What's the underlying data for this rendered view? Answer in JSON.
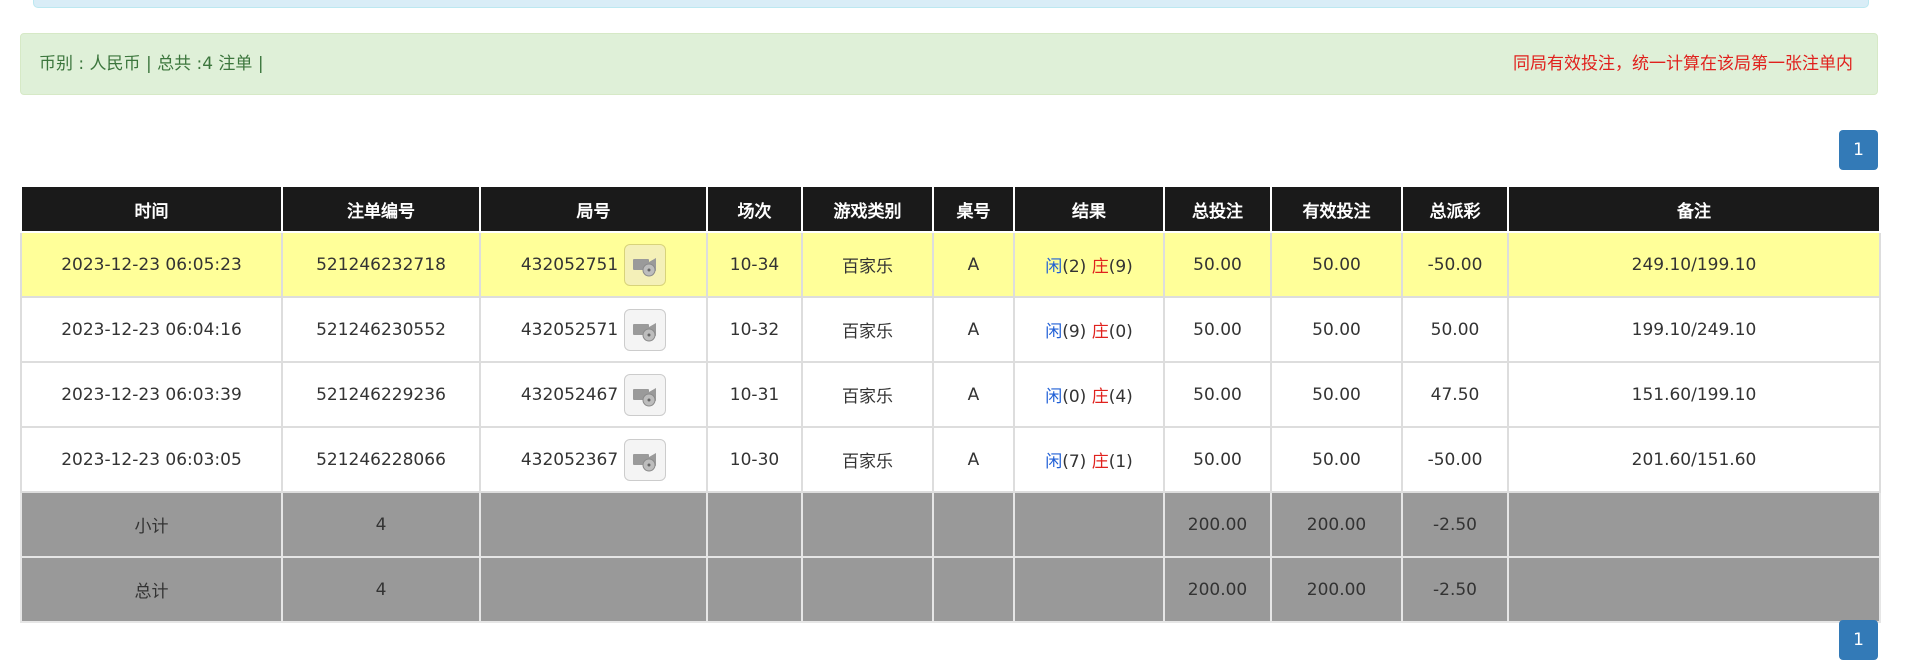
{
  "summary": {
    "left_text": "币别 : 人民币 | 总共 :4 注单 |",
    "right_text": "同局有效投注，统一计算在该局第一张注单内"
  },
  "pagination": {
    "current": "1"
  },
  "table": {
    "headers": [
      "时间",
      "注单编号",
      "局号",
      "场次",
      "游戏类别",
      "桌号",
      "结果",
      "总投注",
      "有效投注",
      "总派彩",
      "备注"
    ],
    "rows": [
      {
        "time": "2023-12-23 06:05:23",
        "bet_id": "521246232718",
        "round": "432052751",
        "session": "10-34",
        "game": "百家乐",
        "table": "A",
        "player_label": "闲",
        "player_score": "(2)",
        "banker_label": "庄",
        "banker_score": "(9)",
        "total_bet": "50.00",
        "valid_bet": "50.00",
        "payout": "-50.00",
        "note": "249.10/199.10"
      },
      {
        "time": "2023-12-23 06:04:16",
        "bet_id": "521246230552",
        "round": "432052571",
        "session": "10-32",
        "game": "百家乐",
        "table": "A",
        "player_label": "闲",
        "player_score": "(9)",
        "banker_label": "庄",
        "banker_score": "(0)",
        "total_bet": "50.00",
        "valid_bet": "50.00",
        "payout": "50.00",
        "note": "199.10/249.10"
      },
      {
        "time": "2023-12-23 06:03:39",
        "bet_id": "521246229236",
        "round": "432052467",
        "session": "10-31",
        "game": "百家乐",
        "table": "A",
        "player_label": "闲",
        "player_score": "(0)",
        "banker_label": "庄",
        "banker_score": "(4)",
        "total_bet": "50.00",
        "valid_bet": "50.00",
        "payout": "47.50",
        "note": "151.60/199.10"
      },
      {
        "time": "2023-12-23 06:03:05",
        "bet_id": "521246228066",
        "round": "432052367",
        "session": "10-30",
        "game": "百家乐",
        "table": "A",
        "player_label": "闲",
        "player_score": "(7)",
        "banker_label": "庄",
        "banker_score": "(1)",
        "total_bet": "50.00",
        "valid_bet": "50.00",
        "payout": "-50.00",
        "note": "201.60/151.60"
      }
    ],
    "subtotal": {
      "label": "小计",
      "count": "4",
      "total_bet": "200.00",
      "valid_bet": "200.00",
      "payout": "-2.50"
    },
    "total": {
      "label": "总计",
      "count": "4",
      "total_bet": "200.00",
      "valid_bet": "200.00",
      "payout": "-2.50"
    }
  },
  "colors": {
    "header_bg": "#1a1a1a",
    "highlight_row": "#ffff99",
    "summary_row": "#999999",
    "blue": "#1f5fd6",
    "red": "#e0211d",
    "pager": "#337ab7"
  },
  "icons": {
    "replay": "video-replay-icon"
  }
}
